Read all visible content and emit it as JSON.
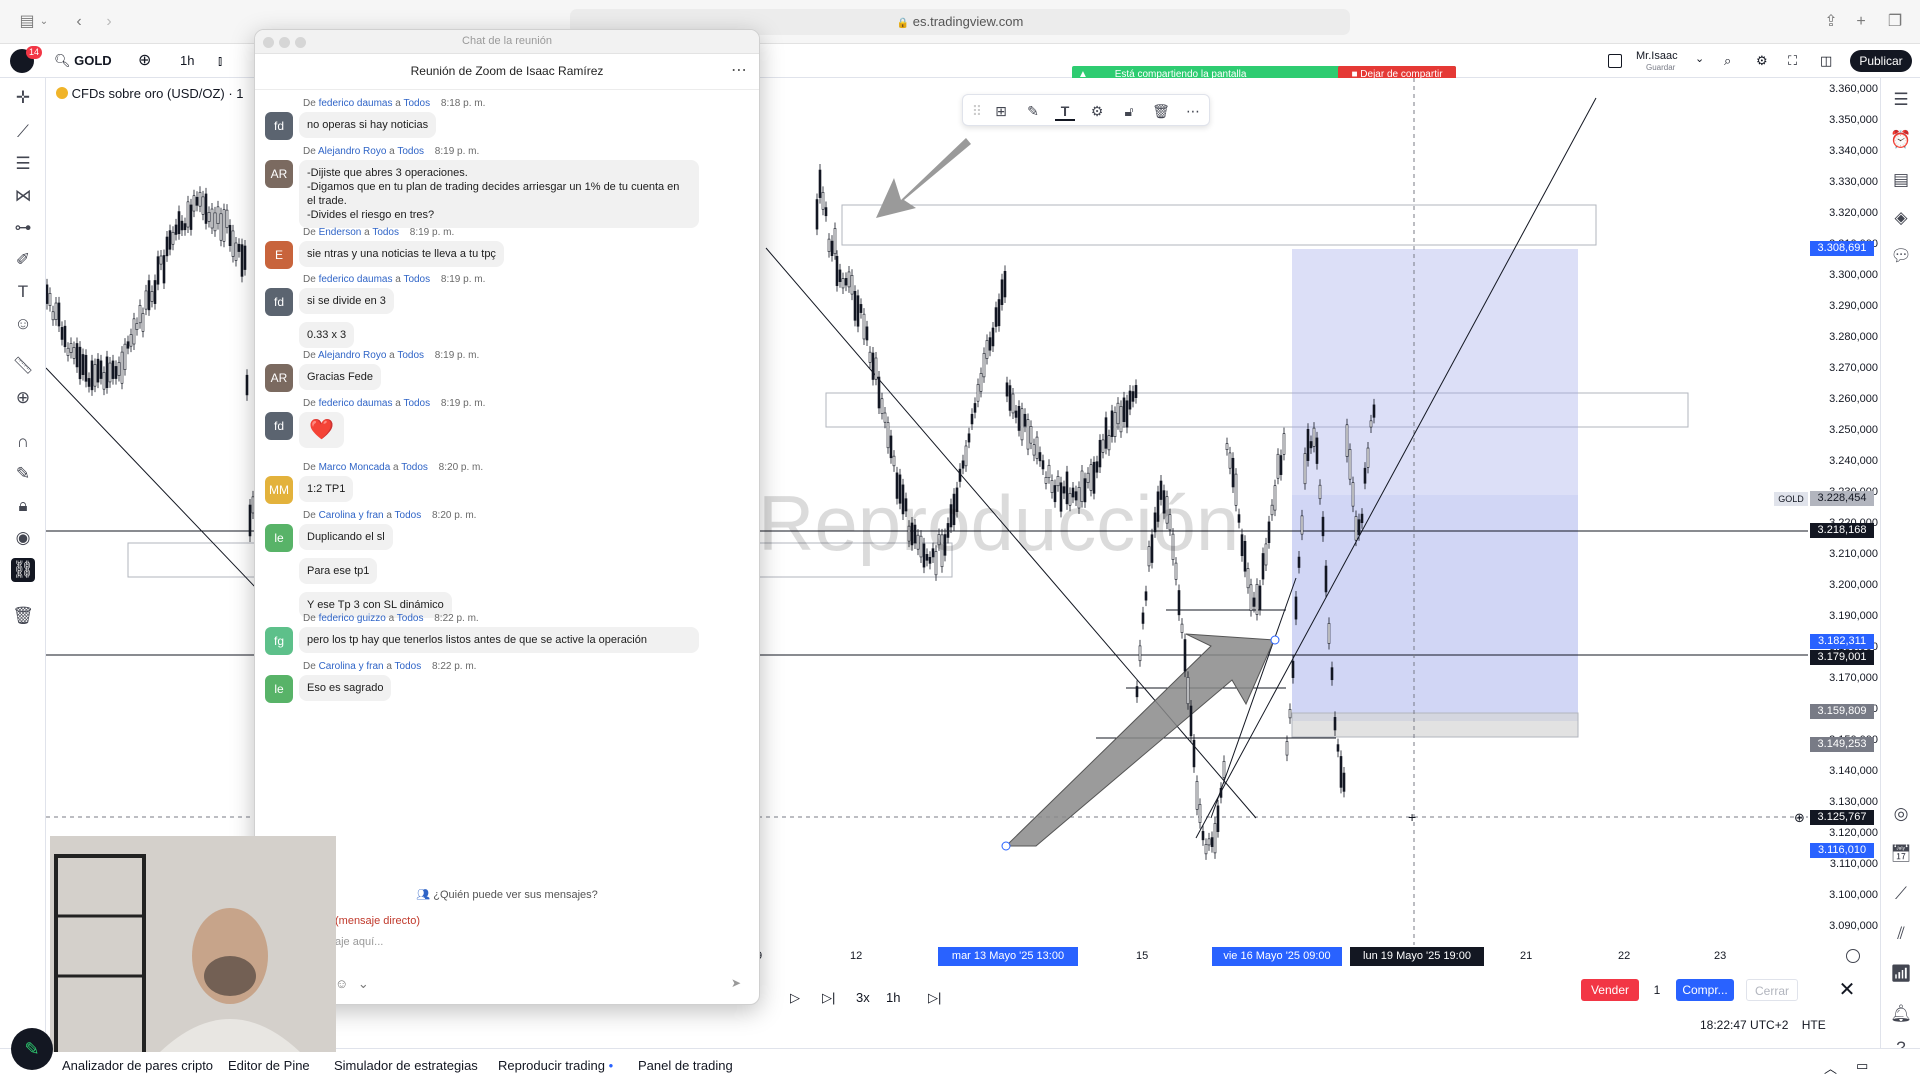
{
  "browser": {
    "url": "es.tradingview.com"
  },
  "toolbar": {
    "notification_count": "14",
    "symbol": "GOLD",
    "interval": "1h",
    "user_name": "Mr.Isaac",
    "user_sub": "Guardar",
    "publish_label": "Publicar"
  },
  "screen_share": {
    "status": "Está compartiendo la pantalla",
    "stop_label": "Dejar de compartir"
  },
  "chart": {
    "title": "CFDs sobre oro (USD/OZ) · 1",
    "watermark": "Reproducción",
    "symbol_tag": "GOLD",
    "price_labels": [
      "3.360,000",
      "3.350,000",
      "3.340,000",
      "3.330,000",
      "3.320,000",
      "3.310,000",
      "3.300,000",
      "3.290,000",
      "3.280,000",
      "3.270,000",
      "3.260,000",
      "3.250,000",
      "3.240,000",
      "3.230,000",
      "3.220,000",
      "3.210,000",
      "3.200,000",
      "3.190,000",
      "3.180,000",
      "3.170,000",
      "3.160,000",
      "3.150,000",
      "3.140,000",
      "3.130,000",
      "3.120,000",
      "3.110,000",
      "3.100,000",
      "3.090,000"
    ],
    "tags": {
      "top_target": "3.308,691",
      "current_gold": "3.228,454",
      "black_line": "3.218,168",
      "blue_entry": "3.182,311",
      "black_entry": "3.179,001",
      "gray_1": "3.159,809",
      "gray_2": "3.149,253",
      "crosshair": "3.125,767",
      "blue_bottom": "3.116,010"
    },
    "time_labels": [
      "9",
      "12",
      "15",
      "21",
      "22",
      "23"
    ],
    "time_highlights": [
      "mar 13 Mayo '25   13:00",
      "vie 16 Mayo '25   09:00",
      "lun 19 Mayo '25   19:00"
    ],
    "colors": {
      "up": "#131722",
      "down": "#131722",
      "blue_zone": "#9aa4e8",
      "tag_blue": "#2962ff",
      "sell_red": "#f23645"
    }
  },
  "replay": {
    "speed": "3x",
    "interval": "1h",
    "sell": "Vender",
    "qty": "1",
    "buy": "Compr...",
    "close": "Cerrar"
  },
  "status": {
    "time": "18:22:47 UTC+2",
    "session": "HTE"
  },
  "bottom_tabs": [
    "Analizador de pares cripto",
    "Editor de Pine",
    "Simulador de estrategias",
    "Reproducir trading",
    "Panel de trading"
  ],
  "chat": {
    "window_title": "Chat de la reunión",
    "meeting_title": "Reunión de Zoom de Isaac Ramírez",
    "messages": [
      {
        "from": "federico daumas",
        "to": "Todos",
        "time": "8:18 p. m.",
        "initials": "fd",
        "color": "#5b6470",
        "text": "no operas si hay noticias"
      },
      {
        "from": "Alejandro Royo",
        "to": "Todos",
        "time": "8:19 p. m.",
        "initials": "AR",
        "color": "#7b6a60",
        "text": "-Dijiste que abres 3 operaciones.\n-Digamos que en tu plan de trading decides arriesgar un 1% de tu cuenta en el trade.\n-Divides el riesgo en tres?"
      },
      {
        "from": "Enderson",
        "to": "Todos",
        "time": "8:19 p. m.",
        "initials": "E",
        "color": "#c8643c",
        "text": "sie ntras y una noticias te lleva a tu tpç"
      },
      {
        "from": "federico daumas",
        "to": "Todos",
        "time": "8:19 p. m.",
        "initials": "fd",
        "color": "#5b6470",
        "text": "si se divide en 3",
        "extra": "0.33 x 3"
      },
      {
        "from": "Alejandro Royo",
        "to": "Todos",
        "time": "8:19 p. m.",
        "initials": "AR",
        "color": "#7b6a60",
        "text": "Gracias Fede"
      },
      {
        "from": "federico daumas",
        "to": "Todos",
        "time": "8:19 p. m.",
        "initials": "fd",
        "color": "#5b6470",
        "text": "❤️"
      },
      {
        "from": "Marco Moncada",
        "to": "Todos",
        "time": "8:20 p. m.",
        "initials": "MM",
        "color": "#e3b23c",
        "text": "1:2 TP1"
      },
      {
        "from": "Carolina y fran",
        "to": "Todos",
        "time": "8:20 p. m.",
        "initials": "le",
        "color": "#58b368",
        "text": "Duplicando el sl",
        "extra": "Para ese tp1",
        "extra2": "Y ese Tp 3 con SL dinámico"
      },
      {
        "from": "federico guizzo",
        "to": "Todos",
        "time": "8:22 p. m.",
        "initials": "fg",
        "color": "#5dc08a",
        "text": "pero los tp hay que tenerlos listos antes de que se active la operación"
      },
      {
        "from": "Carolina y fran",
        "to": "Todos",
        "time": "8:22 p. m.",
        "initials": "le",
        "color": "#58b368",
        "text": "Eso es sagrado"
      }
    ],
    "from_word": "De",
    "to_word": "a",
    "who_can_see": "¿Quién puede ver sus mensajes?",
    "recipient": "(mensaje directo)",
    "input_placeholder": "aje aquí..."
  }
}
